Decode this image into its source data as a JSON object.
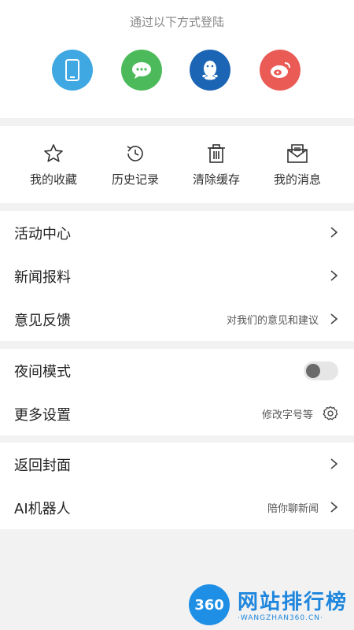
{
  "login": {
    "title": "通过以下方式登陆",
    "options": [
      {
        "icon": "phone-icon",
        "color": "#3fa7e2"
      },
      {
        "icon": "wechat-icon",
        "color": "#4cba5a"
      },
      {
        "icon": "qq-icon",
        "color": "#1c65b5"
      },
      {
        "icon": "weibo-icon",
        "color": "#ea5b56"
      }
    ]
  },
  "quick_actions": [
    {
      "icon": "star-icon",
      "label": "我的收藏"
    },
    {
      "icon": "history-icon",
      "label": "历史记录"
    },
    {
      "icon": "trash-icon",
      "label": "清除缓存"
    },
    {
      "icon": "mail-icon",
      "label": "我的消息"
    }
  ],
  "menu1": [
    {
      "label": "活动中心",
      "hint": ""
    },
    {
      "label": "新闻报料",
      "hint": ""
    },
    {
      "label": "意见反馈",
      "hint": "对我们的意见和建议"
    }
  ],
  "menu2": {
    "night_mode": {
      "label": "夜间模式",
      "enabled": false
    },
    "more_settings": {
      "label": "更多设置",
      "hint": "修改字号等"
    }
  },
  "menu3": [
    {
      "label": "返回封面",
      "hint": ""
    },
    {
      "label": "AI机器人",
      "hint": "陪你聊新闻"
    }
  ],
  "watermark": {
    "logo_text": "360",
    "title": "网站排行榜",
    "subtitle": "·WANGZHAN360.CN·"
  }
}
